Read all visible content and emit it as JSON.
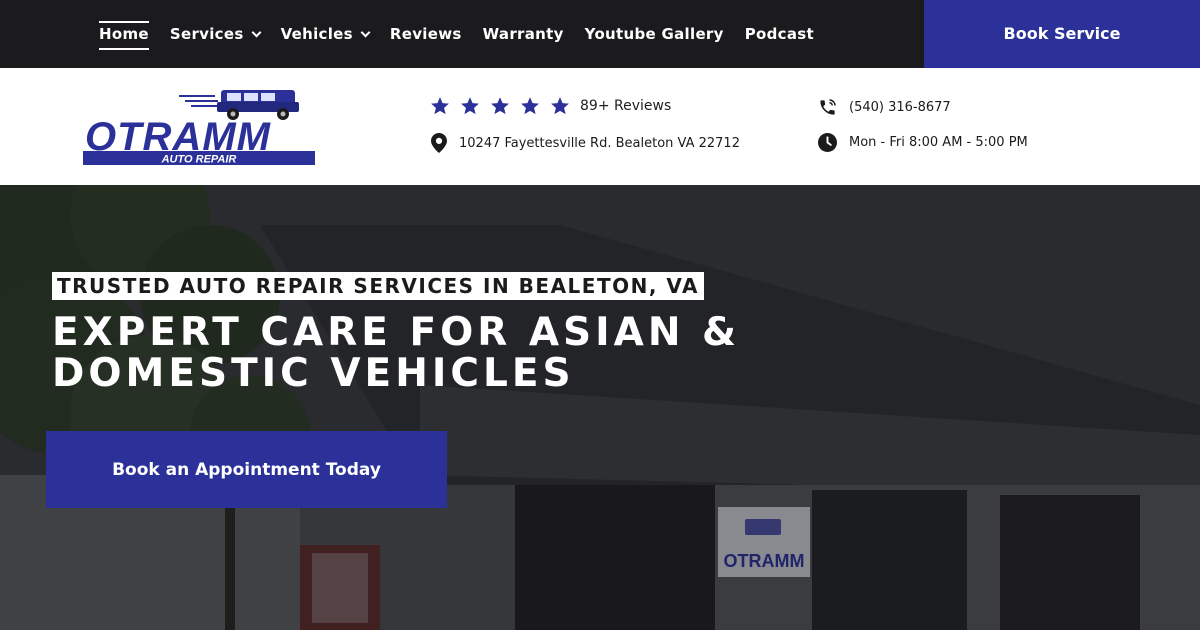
{
  "nav": {
    "items": [
      {
        "label": "Home",
        "active": true,
        "dropdown": false
      },
      {
        "label": "Services",
        "active": false,
        "dropdown": true
      },
      {
        "label": "Vehicles",
        "active": false,
        "dropdown": true
      },
      {
        "label": "Reviews",
        "active": false,
        "dropdown": false
      },
      {
        "label": "Warranty",
        "active": false,
        "dropdown": false
      },
      {
        "label": "Youtube Gallery",
        "active": false,
        "dropdown": false
      },
      {
        "label": "Podcast",
        "active": false,
        "dropdown": false
      }
    ],
    "book_service_label": "Book Service"
  },
  "logo": {
    "brand": "OTRAMM",
    "sub": "AUTO REPAIR"
  },
  "info": {
    "rating_stars": 5,
    "reviews_label": "89+ Reviews",
    "address": "10247 Fayettesville Rd. Bealeton VA 22712",
    "phone": "(540) 316-8677",
    "hours": "Mon - Fri 8:00 AM - 5:00 PM"
  },
  "hero": {
    "tagline": "Trusted Auto Repair Services in Bealeton, VA",
    "headline": "Expert Care for Asian & Domestic Vehicles",
    "cta_label": "Book an Appointment Today",
    "sign_text": "OTRAMM"
  },
  "colors": {
    "brand_blue": "#2b3199",
    "nav_dark": "#1b1b1d",
    "star": "#2b3199"
  },
  "icons": [
    "chevron-down-icon",
    "star-icon",
    "map-pin-icon",
    "phone-icon",
    "clock-icon"
  ]
}
